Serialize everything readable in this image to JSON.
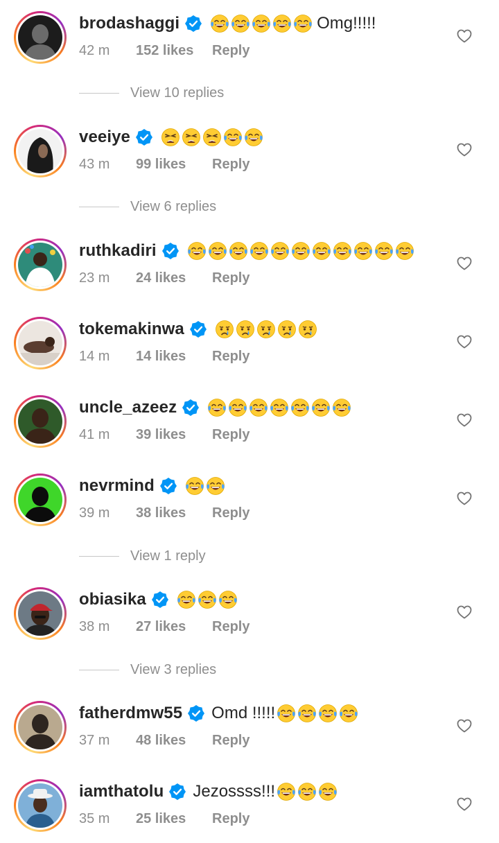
{
  "meta": {
    "reply_label": "Reply"
  },
  "comments": [
    {
      "username": "brodashaggi",
      "verified": true,
      "text": "",
      "emoji": [
        "joy",
        "joy",
        "joy",
        "joy",
        "joy"
      ],
      "after_text": "Omg!!!!!",
      "time": "42 m",
      "likes": "152 likes",
      "replies_label": "View 10 replies",
      "avatar": {
        "bg": "#1c1c1c",
        "fg": "#6b6b6b",
        "shape": "portrait"
      }
    },
    {
      "username": "veeiye",
      "verified": true,
      "text": "",
      "emoji": [
        "weary",
        "weary",
        "weary",
        "joy",
        "joy"
      ],
      "after_text": "",
      "time": "43 m",
      "likes": "99 likes",
      "replies_label": "View 6 replies",
      "avatar": {
        "bg": "#f2f2f2",
        "fg": "#1a1a1a",
        "shape": "hood"
      }
    },
    {
      "username": "ruthkadiri",
      "verified": true,
      "text": "",
      "emoji": [
        "joy",
        "joy",
        "joy",
        "joy",
        "joy",
        "joy",
        "joy",
        "joy",
        "joy",
        "joy",
        "joy"
      ],
      "after_text": "",
      "time": "23 m",
      "likes": "24 likes",
      "replies_label": "",
      "avatar": {
        "bg": "#2e8b7a",
        "fg": "#e05050",
        "shape": "party"
      }
    },
    {
      "username": "tokemakinwa",
      "verified": true,
      "text": "",
      "emoji": [
        "cry",
        "cry",
        "cry",
        "cry",
        "cry"
      ],
      "after_text": "",
      "time": "14 m",
      "likes": "14 likes",
      "replies_label": "",
      "avatar": {
        "bg": "#ece6e0",
        "fg": "#5a3d30",
        "shape": "lying"
      }
    },
    {
      "username": "uncle_azeez",
      "verified": true,
      "text": "",
      "emoji": [
        "joy",
        "joy",
        "joy",
        "joy",
        "joy",
        "joy",
        "joy"
      ],
      "after_text": "",
      "time": "41 m",
      "likes": "39 likes",
      "replies_label": "",
      "avatar": {
        "bg": "#2f5a2a",
        "fg": "#3a2418",
        "shape": "portrait"
      }
    },
    {
      "username": "nevrmind",
      "verified": true,
      "text": "",
      "emoji": [
        "joy",
        "joy"
      ],
      "after_text": "",
      "time": "39 m",
      "likes": "38 likes",
      "replies_label": "View 1 reply",
      "avatar": {
        "bg": "#3fd62a",
        "fg": "#0c0c0c",
        "shape": "portrait"
      }
    },
    {
      "username": "obiasika",
      "verified": true,
      "text": "",
      "emoji": [
        "joy",
        "joy",
        "joy"
      ],
      "after_text": "",
      "time": "38 m",
      "likes": "27 likes",
      "replies_label": "View 3 replies",
      "avatar": {
        "bg": "#6d7a85",
        "fg": "#c0262e",
        "shape": "cap"
      }
    },
    {
      "username": "fatherdmw55",
      "verified": true,
      "text": "Omd !!!!!",
      "emoji": [
        "joy",
        "joy",
        "joy",
        "joy"
      ],
      "after_text": "",
      "time": "37 m",
      "likes": "48 likes",
      "replies_label": "",
      "avatar": {
        "bg": "#b9a98f",
        "fg": "#2d2520",
        "shape": "portrait"
      }
    },
    {
      "username": "iamthatolu",
      "verified": true,
      "text": "Jezossss!!!",
      "emoji": [
        "joy",
        "joy",
        "joy"
      ],
      "after_text": "",
      "time": "35 m",
      "likes": "25 likes",
      "replies_label": "",
      "avatar": {
        "bg": "#7fb0d8",
        "fg": "#f2f2f2",
        "shape": "hat"
      }
    }
  ]
}
